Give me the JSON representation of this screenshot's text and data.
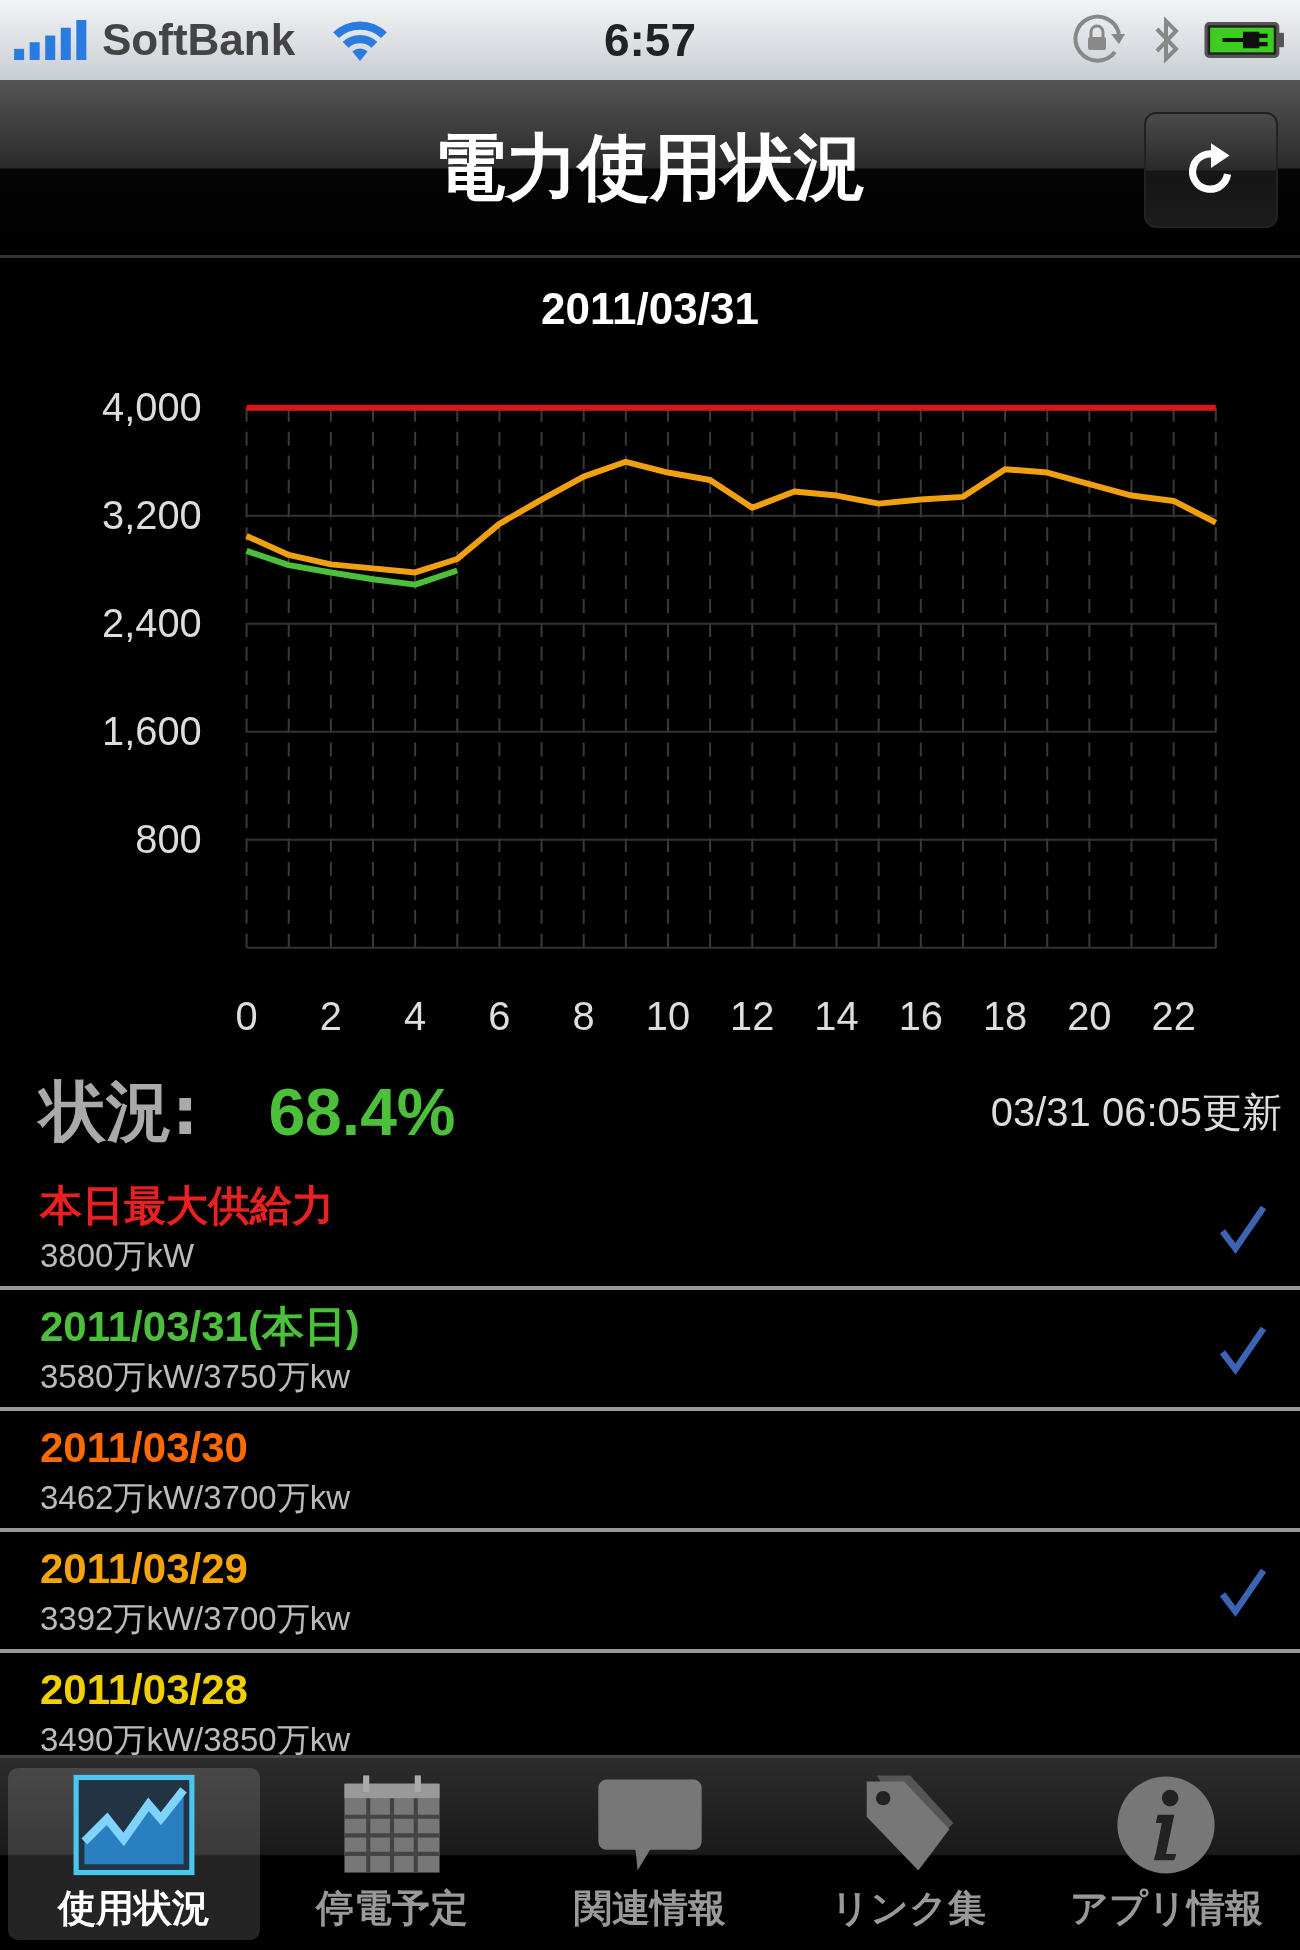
{
  "status_bar": {
    "carrier": "SoftBank",
    "time": "6:57"
  },
  "nav_bar": {
    "title": "電力使用状況"
  },
  "chart": {
    "chart_data": {
      "type": "line",
      "title": "2011/03/31",
      "x": [
        0,
        1,
        2,
        3,
        4,
        5,
        6,
        7,
        8,
        9,
        10,
        11,
        12,
        13,
        14,
        15,
        16,
        17,
        18,
        19,
        20,
        21,
        22,
        23
      ],
      "xlim": [
        0,
        23
      ],
      "grid": true,
      "xticks": [
        0,
        2,
        4,
        6,
        8,
        10,
        12,
        14,
        16,
        18,
        20,
        22
      ],
      "yticks": [
        {
          "value": 800,
          "label": "800"
        },
        {
          "value": 1600,
          "label": "1,600"
        },
        {
          "value": 2400,
          "label": "2,400"
        },
        {
          "value": 3200,
          "label": "3,200"
        },
        {
          "value": 4000,
          "label": "4,000"
        }
      ],
      "ylim": [
        0,
        4000
      ],
      "series": [
        {
          "color": "#d81818",
          "values": [
            4000,
            4000,
            4000,
            4000,
            4000,
            4000,
            4000,
            4000,
            4000,
            4000,
            4000,
            4000,
            4000,
            4000,
            4000,
            4000,
            4000,
            4000,
            4000,
            4000,
            4000,
            4000,
            4000,
            4000
          ]
        },
        {
          "color": "#f0a010",
          "values": [
            3050,
            2910,
            2840,
            2810,
            2780,
            2880,
            3140,
            3320,
            3490,
            3600,
            3520,
            3465,
            3260,
            3380,
            3350,
            3290,
            3320,
            3340,
            3545,
            3520,
            3435,
            3350,
            3310,
            3150
          ]
        },
        {
          "color": "#4cc03a",
          "values": [
            2940,
            2835,
            2780,
            2730,
            2690,
            2795,
            null,
            null,
            null,
            null,
            null,
            null,
            null,
            null,
            null,
            null,
            null,
            null,
            null,
            null,
            null,
            null,
            null,
            null
          ]
        }
      ]
    }
  },
  "summary": {
    "label": "状況:",
    "value": "68.4%",
    "updated": "03/31 06:05更新"
  },
  "legend": [
    {
      "title": "本日最大供給力",
      "detail": "3800万kW",
      "color": "#e82020",
      "checked": true
    },
    {
      "title": "2011/03/31(本日)",
      "detail": "3580万kW/3750万kw",
      "color": "#4cc03a",
      "checked": true
    },
    {
      "title": "2011/03/30",
      "detail": "3462万kW/3700万kw",
      "color": "#ff6a00",
      "checked": false
    },
    {
      "title": "2011/03/29",
      "detail": "3392万kW/3700万kw",
      "color": "#f5a50a",
      "checked": true
    },
    {
      "title": "2011/03/28",
      "detail": "3490万kW/3850万kw",
      "color": "#f0d000",
      "checked": false
    }
  ],
  "tabs": [
    {
      "label": "使用状況",
      "kind": "chart",
      "selected": true
    },
    {
      "label": "停電予定",
      "kind": "calendar",
      "selected": false
    },
    {
      "label": "関連情報",
      "kind": "bubble",
      "selected": false
    },
    {
      "label": "リンク集",
      "kind": "tag",
      "selected": false
    },
    {
      "label": "アプリ情報",
      "kind": "info",
      "selected": false
    }
  ]
}
